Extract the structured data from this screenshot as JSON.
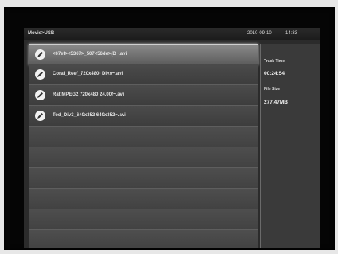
{
  "header": {
    "breadcrumb": "Movie>USB",
    "date": "2010-09-10",
    "time": "14:33"
  },
  "files": [
    {
      "label": "<67ef><5367>_507<56de>(D~.avi",
      "icon": "pencil-icon",
      "selected": true
    },
    {
      "label": "Coral_Reef_720x480- Divx~.avi",
      "icon": "pencil-icon",
      "selected": false
    },
    {
      "label": "Rat MPEG2 720x480 24.00f~.avi",
      "icon": "pencil-icon",
      "selected": false
    },
    {
      "label": "Tod_Div3_640x352 640x352~.avi",
      "icon": "pencil-icon",
      "selected": false
    }
  ],
  "info": {
    "track_time_label": "Track Time",
    "track_time_value": "00:24:54",
    "file_size_label": "File Size",
    "file_size_value": "277.47MB"
  },
  "colors": {
    "selected_row": "#8a8a8a",
    "row": "#444444",
    "background": "#2b2b2b"
  }
}
